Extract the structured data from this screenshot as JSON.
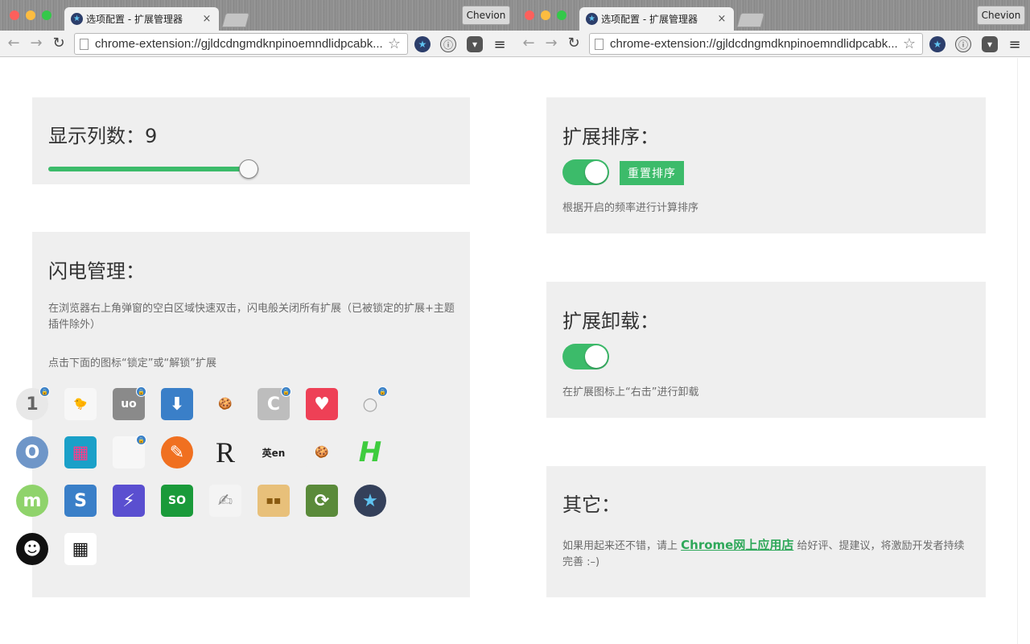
{
  "browser": {
    "tab_title": "选项配置 - 扩展管理器",
    "close_glyph": "×",
    "profile_name": "Chevion",
    "url": "chrome-extension://gjldcdngmdknpinoemndlidpcabk...",
    "back_glyph": "←",
    "forward_glyph": "→",
    "reload_glyph": "↻",
    "bookmark_glyph": "☆",
    "menu_glyph": "≡",
    "ext_star_glyph": "★",
    "ext_info_glyph": "ⓘ",
    "ext_pocket_glyph": "▾",
    "colors": {
      "close": "#fc605c",
      "minimize": "#fdbc40",
      "zoom": "#34c84a"
    }
  },
  "left": {
    "columns": {
      "title": "显示列数：9",
      "slider_fraction": 0.95
    },
    "flash": {
      "title": "闪电管理：",
      "desc1": "在浏览器右上角弹窗的空白区域快速双击，闪电般关闭所有扩展（已被锁定的扩展+主题插件除外）",
      "desc2": "点击下面的图标“锁定”或“解锁”扩展",
      "icons": [
        {
          "name": "onepassword-icon",
          "glyph": "1",
          "bg": "#e8e8e8",
          "fg": "#666",
          "round": true,
          "locked": true
        },
        {
          "name": "chick-icon",
          "glyph": "🐤",
          "bg": "#f7f7f7",
          "fg": "#d7a800",
          "round": false,
          "locked": false
        },
        {
          "name": "ublock-icon",
          "glyph": "uo",
          "bg": "#8a8a8a",
          "fg": "#fff",
          "round": false,
          "locked": true
        },
        {
          "name": "download-icon",
          "glyph": "⬇",
          "bg": "#3a7fc8",
          "fg": "#fff",
          "round": false,
          "locked": false
        },
        {
          "name": "cookie-icon",
          "glyph": "🍪",
          "bg": "#efefef",
          "fg": "#b07a2a",
          "round": true,
          "locked": false
        },
        {
          "name": "c-logo-icon",
          "glyph": "C",
          "bg": "#bdbdbd",
          "fg": "#fff",
          "round": false,
          "locked": true
        },
        {
          "name": "pocket-icon",
          "glyph": "♥",
          "bg": "#ee4056",
          "fg": "#fff",
          "round": false,
          "locked": false
        },
        {
          "name": "ring-icon",
          "glyph": "○",
          "bg": "#efefef",
          "fg": "#aaa",
          "round": true,
          "locked": true
        },
        {
          "name": "o-ring-icon",
          "glyph": "O",
          "bg": "#6f96c8",
          "fg": "#fff",
          "round": true,
          "locked": false
        },
        {
          "name": "tiles-icon",
          "glyph": "▦",
          "bg": "#1aa0c8",
          "fg": "#ff3a8a",
          "round": false,
          "locked": false
        },
        {
          "name": "blank-extension-icon",
          "glyph": "",
          "bg": "#f7f7f7",
          "fg": "#ccc",
          "round": false,
          "locked": true
        },
        {
          "name": "paint-pen-icon",
          "glyph": "✎",
          "bg": "#f07020",
          "fg": "#fff",
          "round": true,
          "locked": false
        },
        {
          "name": "r-logo-icon",
          "glyph": "R",
          "bg": "transparent",
          "fg": "#222",
          "round": false,
          "locked": false
        },
        {
          "name": "translate-icon",
          "glyph": "英en",
          "bg": "transparent",
          "fg": "#222",
          "round": false,
          "locked": false
        },
        {
          "name": "cookies-group-icon",
          "glyph": "🍪",
          "bg": "#efefef",
          "fg": "#c07a20",
          "round": false,
          "locked": false
        },
        {
          "name": "h-logo-icon",
          "glyph": "H",
          "bg": "transparent",
          "fg": "#3ecc3e",
          "round": false,
          "locked": false
        },
        {
          "name": "m-logo-icon",
          "glyph": "m",
          "bg": "#8fd36b",
          "fg": "#fff",
          "round": true,
          "locked": false
        },
        {
          "name": "s-logo-icon",
          "glyph": "S",
          "bg": "#3a7fc8",
          "fg": "#fff",
          "round": false,
          "locked": false
        },
        {
          "name": "lightning-icon",
          "glyph": "⚡",
          "bg": "#5a4fd0",
          "fg": "#fff",
          "round": false,
          "locked": false
        },
        {
          "name": "so-flag-icon",
          "glyph": "SO",
          "bg": "#1a9a3a",
          "fg": "#fff",
          "round": false,
          "locked": false
        },
        {
          "name": "notepad-icon",
          "glyph": "✍",
          "bg": "#f4f4f4",
          "fg": "#888",
          "round": false,
          "locked": false
        },
        {
          "name": "radio-icon",
          "glyph": "▪▪",
          "bg": "#e8c07a",
          "fg": "#8a5a10",
          "round": false,
          "locked": false
        },
        {
          "name": "sync-books-icon",
          "glyph": "⟳",
          "bg": "#5a8a3a",
          "fg": "#fff",
          "round": false,
          "locked": false
        },
        {
          "name": "star-badge-icon",
          "glyph": "★",
          "bg": "#34405a",
          "fg": "#5fc3f0",
          "round": true,
          "locked": false
        },
        {
          "name": "afro-avatar-icon",
          "glyph": "☻",
          "bg": "#111",
          "fg": "#fff",
          "round": true,
          "locked": false
        },
        {
          "name": "qr-code-icon",
          "glyph": "▦",
          "bg": "#fff",
          "fg": "#111",
          "round": false,
          "locked": false
        }
      ]
    }
  },
  "right": {
    "sort": {
      "title": "扩展排序：",
      "reset_label": "重置排序",
      "desc": "根据开启的频率进行计算排序"
    },
    "uninstall": {
      "title": "扩展卸载：",
      "desc": "在扩展图标上“右击”进行卸载"
    },
    "other": {
      "title": "其它：",
      "desc_before": "如果用起来还不错，请上 ",
      "link": "Chrome网上应用店",
      "desc_after": " 给好评、提建议，将激励开发者持续完善 :–)"
    }
  }
}
